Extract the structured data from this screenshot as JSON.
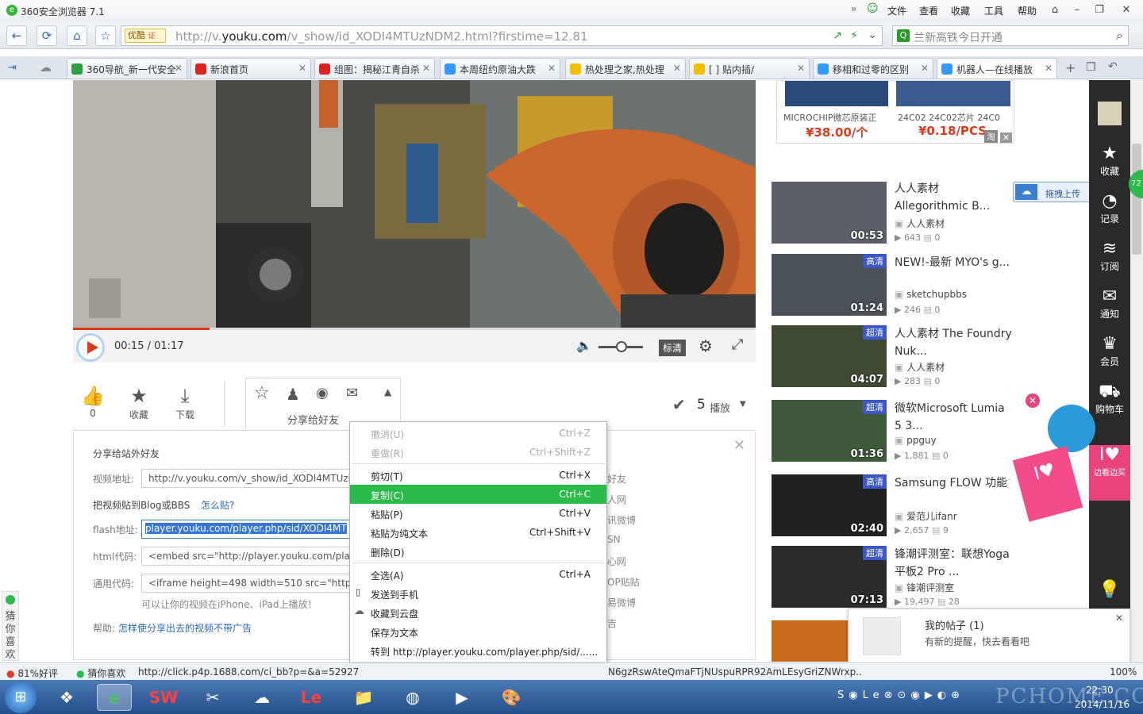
{
  "browser": {
    "title": "360安全浏览器 7.1",
    "menu": [
      "文件",
      "查看",
      "收藏",
      "工具",
      "帮助"
    ],
    "url_badge": "优酷",
    "url_prefix": "http://v.",
    "url_domain": "youku.com",
    "url_rest": "/v_show/id_XODI4MTUzNDM2.html?firstime=12.81",
    "search_placeholder": "兰新高铁今日开通"
  },
  "tabs": [
    {
      "label": "360导航_新一代安全",
      "color": "#2ea043"
    },
    {
      "label": "新浪首页",
      "color": "#d22"
    },
    {
      "label": "组图：揭秘江青自杀",
      "color": "#d22"
    },
    {
      "label": "本周纽约原油大跌",
      "color": "#39f"
    },
    {
      "label": "热处理之家,热处理",
      "color": "#f0c000"
    },
    {
      "label": "[ ] 贴内插/",
      "color": "#f0c000"
    },
    {
      "label": "移相和过零的区别",
      "color": "#39f"
    },
    {
      "label": "机器人—在线播放",
      "color": "#39f"
    }
  ],
  "player": {
    "time": "00:15 / 01:17",
    "quality": "标清",
    "progress": 0.2
  },
  "actions": {
    "like_count": "0",
    "favorite": "收藏",
    "download": "下载",
    "share_friends": "分享给好友",
    "plays_count": "5",
    "plays_label": "播放"
  },
  "share": {
    "heading": "分享给站外好友",
    "video_url_label": "视频地址:",
    "video_url": "http://v.youku.com/v_show/id_XODI4MTUzN",
    "blog_label": "把视频贴到Blog或BBS",
    "how_link": "怎么贴?",
    "flash_label": "flash地址:",
    "flash_value": "player.youku.com/player.php/sid/XODI4MT",
    "html_label": "html代码:",
    "html_value": "<embed src=\"http://player.youku.com/play",
    "generic_label": "通用代码:",
    "generic_value": "<iframe height=498 width=510 src=\"http://",
    "iphone_note": "可以让你的视频在iPhone、iPad上播放！",
    "help_label": "帮助:",
    "help_link": "怎样使分享出去的视频不带广告",
    "right_items": [
      "好友",
      "人网",
      "讯微博",
      "SN",
      "心网",
      "OP贴贴",
      "易微博",
      "吉"
    ]
  },
  "context_menu": [
    {
      "label": "撤消(U)",
      "key": "Ctrl+Z",
      "disabled": true
    },
    {
      "label": "重做(R)",
      "key": "Ctrl+Shift+Z",
      "disabled": true
    },
    {
      "label": "剪切(T)",
      "key": "Ctrl+X"
    },
    {
      "label": "复制(C)",
      "key": "Ctrl+C",
      "selected": true
    },
    {
      "label": "粘贴(P)",
      "key": "Ctrl+V"
    },
    {
      "label": "粘贴为纯文本",
      "key": "Ctrl+Shift+V"
    },
    {
      "label": "删除(D)",
      "key": ""
    },
    {
      "label": "全选(A)",
      "key": "Ctrl+A"
    },
    {
      "label": "发送到手机",
      "key": ""
    },
    {
      "label": "收藏到云盘",
      "key": ""
    },
    {
      "label": "保存为文本",
      "key": ""
    },
    {
      "label": "转到 http://player.youku.com/player.php/sid/......",
      "key": ""
    },
    {
      "label": "审查元素(N)",
      "key": ""
    }
  ],
  "ad": {
    "item1_name": "MICROCHIP微芯原装正",
    "item1_price": "¥38.00/个",
    "item2_name": "24C02 24C02芯片 24C0",
    "item2_price": "¥0.18/PCS"
  },
  "videos": [
    {
      "title": "人人素材 Allegorithmic B...",
      "author": "人人素材",
      "views": "643",
      "comments": "0",
      "duration": "00:53",
      "tag": ""
    },
    {
      "title": "NEW!-最新 MYO's g...",
      "author": "sketchupbbs",
      "views": "246",
      "comments": "0",
      "duration": "01:24",
      "tag": "高清"
    },
    {
      "title": "人人素材 The Foundry Nuk...",
      "author": "人人素材",
      "views": "283",
      "comments": "0",
      "duration": "04:07",
      "tag": "超清"
    },
    {
      "title": "微软Microsoft Lumia 5 3...",
      "author": "ppguy",
      "views": "1,881",
      "comments": "0",
      "duration": "01:36",
      "tag": "超清"
    },
    {
      "title": "Samsung FLOW 功能",
      "author": "爱范儿ifanr",
      "views": "2,657",
      "comments": "9",
      "duration": "02:40",
      "tag": "高清"
    },
    {
      "title": "锋潮评测室：联想Yoga 平板2 Pro ...",
      "author": "锋潮评测室",
      "views": "19,497",
      "comments": "28",
      "duration": "07:13",
      "tag": "超清"
    }
  ],
  "upload_btn": "拖拽上传",
  "sidebar": [
    "收藏",
    "记录",
    "订阅",
    "通知",
    "会员",
    "购物车",
    "边看边买"
  ],
  "notification": {
    "title": "我的帖子 (1)",
    "body": "有新的提醒，快去看看吧"
  },
  "guess": "猜你喜欢",
  "status": {
    "rating": "81%好评",
    "guess": "猜你喜欢",
    "link": "http://click.p4p.1688.com/ci_bb?p=&a=52927",
    "tail": "N6gzRswAteQmaFTjNUspuRPR92AmLEsyGriZNWrxp...",
    "zoom": "100%"
  },
  "clock": {
    "time": "22:30",
    "date": "2014/11/16"
  },
  "watermark": "PCHOME.COM"
}
